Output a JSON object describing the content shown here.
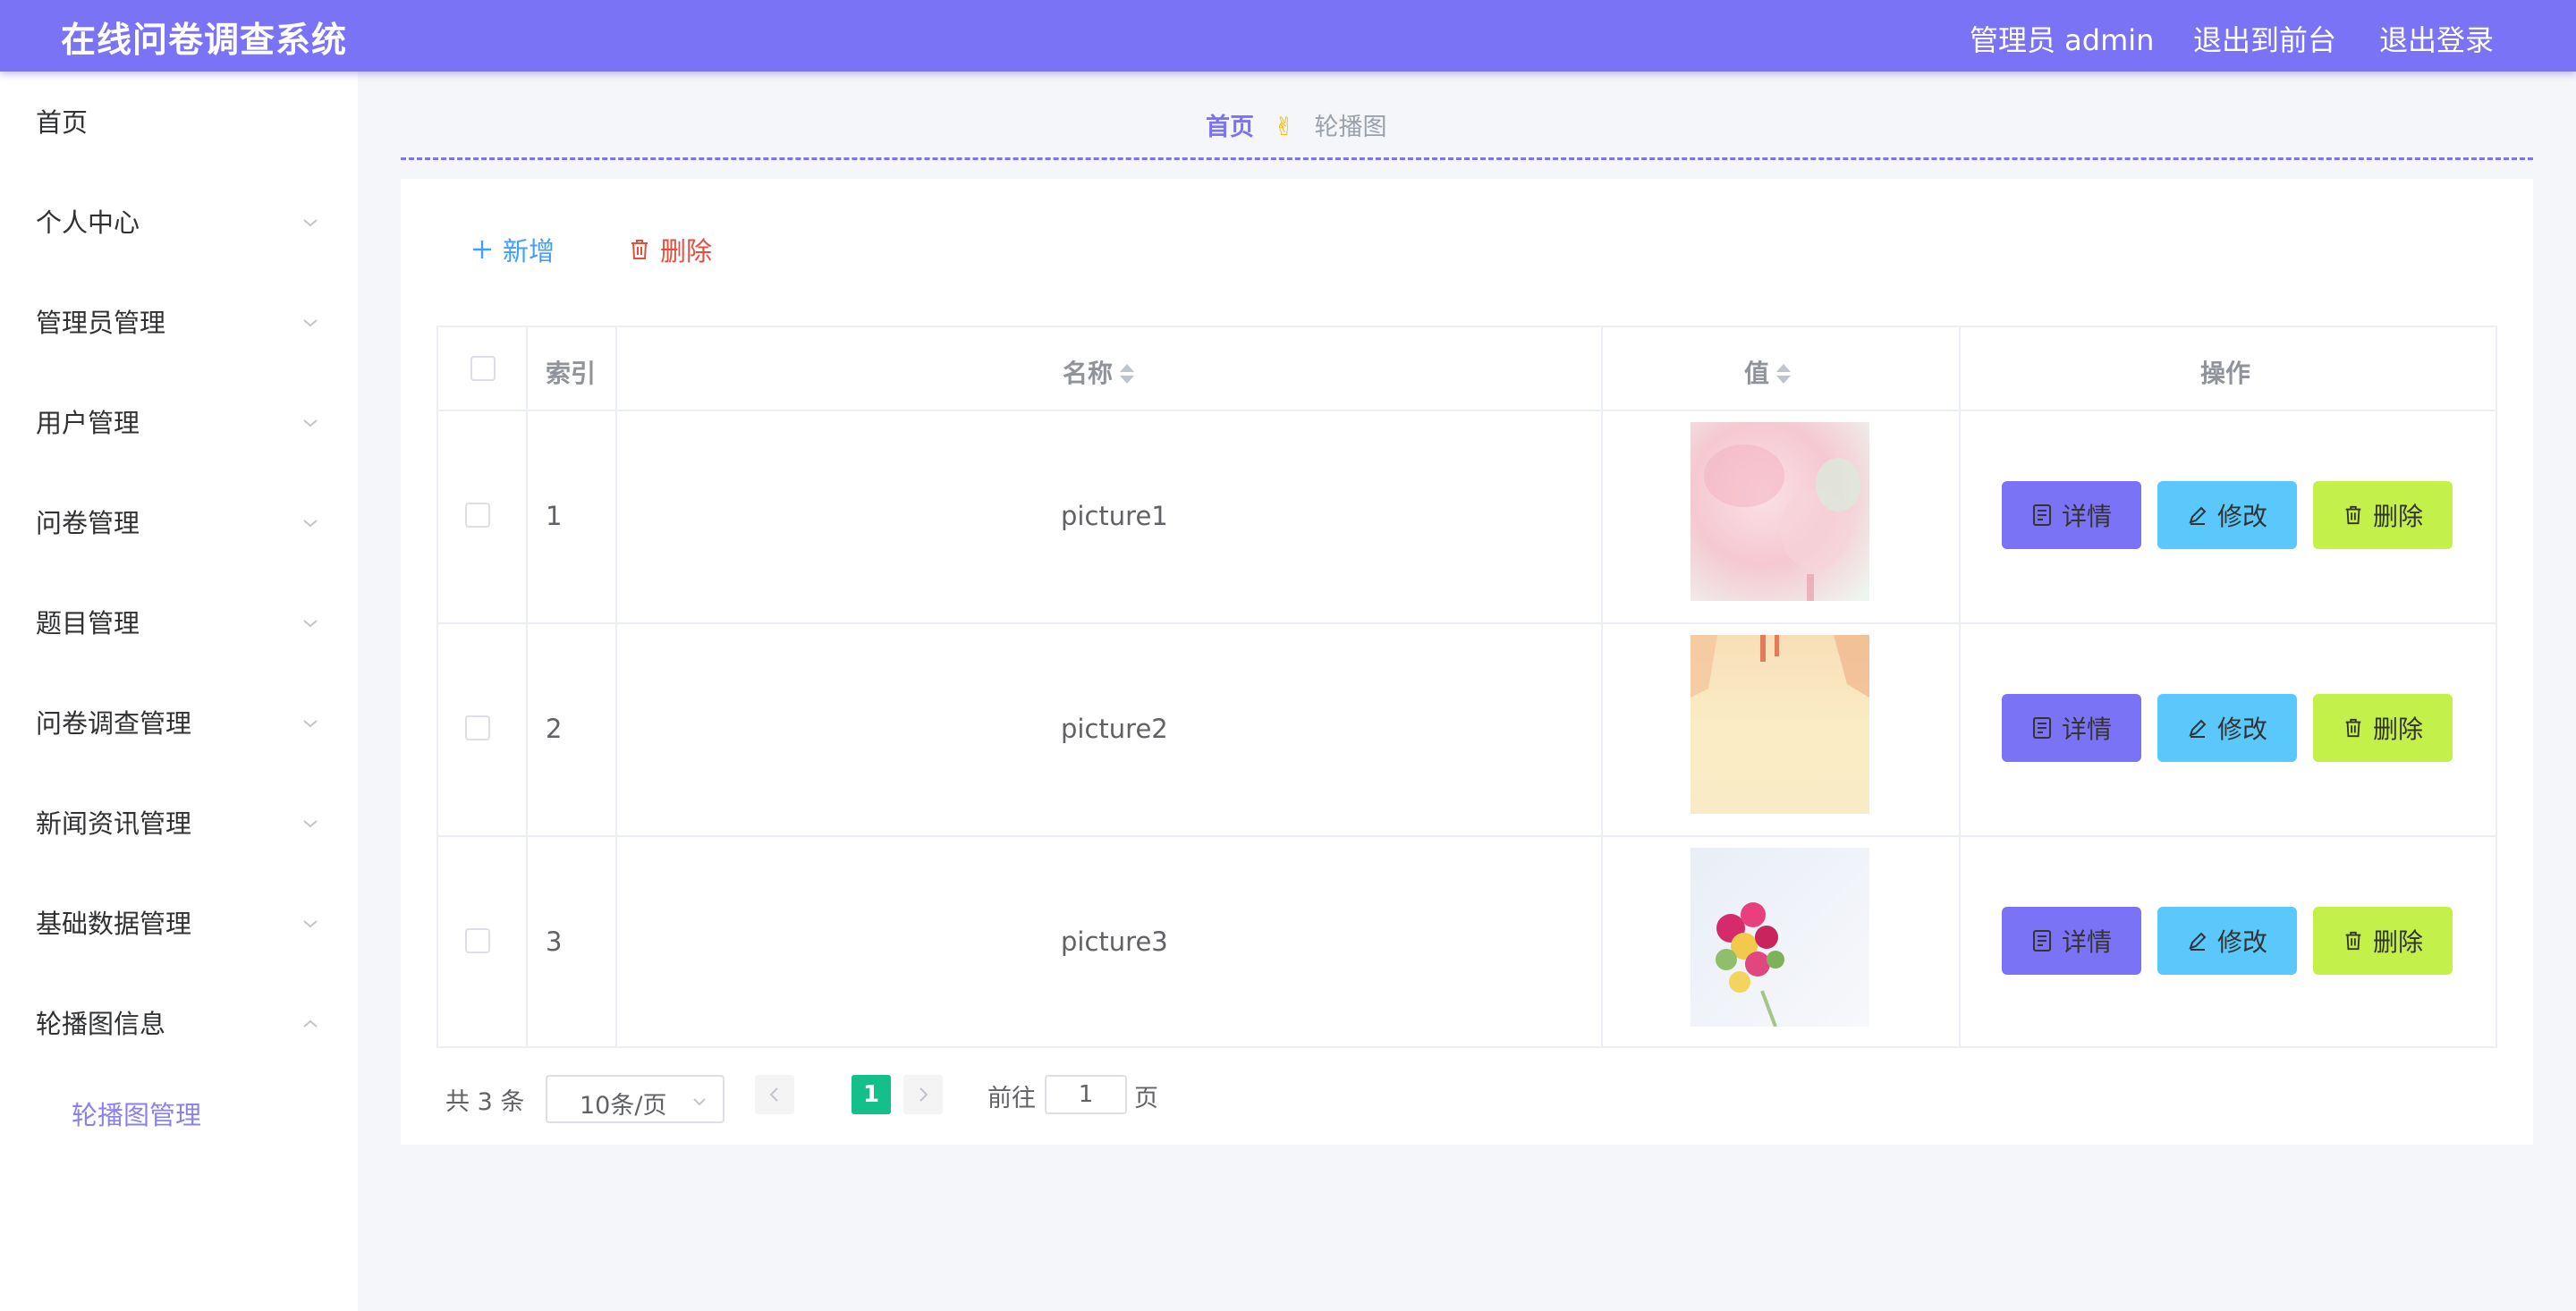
{
  "header": {
    "title": "在线问卷调查系统",
    "user": "管理员 admin",
    "to_front": "退出到前台",
    "logout": "退出登录",
    "color": "#7b73f5"
  },
  "sidebar": {
    "items": [
      {
        "label": "首页",
        "icon": "none"
      },
      {
        "label": "个人中心",
        "icon": "chevron-down-icon"
      },
      {
        "label": "管理员管理",
        "icon": "chevron-down-icon"
      },
      {
        "label": "用户管理",
        "icon": "chevron-down-icon"
      },
      {
        "label": "问卷管理",
        "icon": "chevron-down-icon"
      },
      {
        "label": "题目管理",
        "icon": "chevron-down-icon"
      },
      {
        "label": "问卷调查管理",
        "icon": "chevron-down-icon"
      },
      {
        "label": "新闻资讯管理",
        "icon": "chevron-down-icon"
      },
      {
        "label": "基础数据管理",
        "icon": "chevron-down-icon"
      },
      {
        "label": "轮播图信息",
        "icon": "chevron-up-icon"
      }
    ],
    "submenu": [
      {
        "label": "轮播图管理",
        "active": true
      }
    ]
  },
  "breadcrumb": {
    "home": "首页",
    "separator": "✌",
    "current": "轮播图"
  },
  "toolbar": {
    "add_label": "新增",
    "delete_label": "删除"
  },
  "table": {
    "headers": {
      "index": "索引",
      "name": "名称",
      "value": "值",
      "actions": "操作"
    },
    "rows": [
      {
        "index": "1",
        "name": "picture1",
        "image": "pink-floral-thumbnail"
      },
      {
        "index": "2",
        "name": "picture2",
        "image": "cream-yellow-thumbnail"
      },
      {
        "index": "3",
        "name": "picture3",
        "image": "flower-bouquet-thumbnail"
      }
    ],
    "actions": {
      "detail": "详情",
      "edit": "修改",
      "delete": "删除"
    },
    "action_colors": {
      "detail": "#7b73f5",
      "edit": "#5ac8fa",
      "delete": "#c4f04a"
    }
  },
  "pagination": {
    "total": "共 3 条",
    "page_size": "10条/页",
    "current_page": "1",
    "goto_label": "前往",
    "goto_value": "1",
    "page_suffix": "页"
  }
}
